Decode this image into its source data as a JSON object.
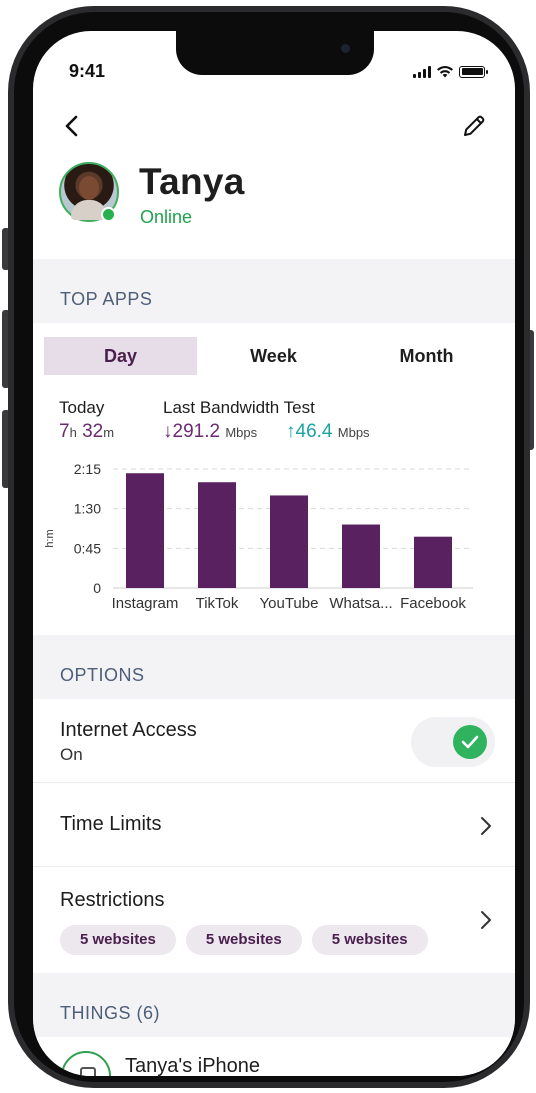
{
  "status_bar": {
    "time": "9:41"
  },
  "header": {
    "back_icon": "chevron-left-icon",
    "edit_icon": "pencil-icon"
  },
  "profile": {
    "name": "Tanya",
    "status": "Online",
    "status_color": "#1fa24a"
  },
  "top_apps": {
    "section_title": "TOP APPS",
    "tabs": [
      {
        "label": "Day",
        "selected": true
      },
      {
        "label": "Week",
        "selected": false
      },
      {
        "label": "Month",
        "selected": false
      }
    ],
    "today_label": "Today",
    "today_hours": "7",
    "today_hours_unit": "h",
    "today_minutes": "32",
    "today_minutes_unit": "m",
    "bandwidth_label": "Last Bandwidth Test",
    "download_value": "291.2",
    "upload_value": "46.4",
    "speed_unit": "Mbps"
  },
  "chart_data": {
    "type": "bar",
    "categories": [
      "Instagram",
      "TikTok",
      "YouTube",
      "Whatsa...",
      "Facebook"
    ],
    "values": [
      2.17,
      2.0,
      1.75,
      1.2,
      0.97
    ],
    "ylabel": "h:m",
    "ylim": [
      0,
      2.25
    ],
    "yticks": [
      0,
      0.75,
      1.5,
      2.25
    ],
    "ytick_labels": [
      "0",
      "0:45",
      "1:30",
      "2:15"
    ],
    "bar_color": "#5a2160",
    "grid": true
  },
  "options": {
    "section_title": "OPTIONS",
    "internet_access": {
      "title": "Internet Access",
      "value": "On",
      "toggle_on": true
    },
    "time_limits": {
      "title": "Time Limits"
    },
    "restrictions": {
      "title": "Restrictions",
      "pills": [
        "5 websites",
        "5 websites",
        "5 websites"
      ]
    }
  },
  "things": {
    "section_title": "THINGS (6)",
    "items": [
      {
        "name": "Tanya's iPhone",
        "icon": "phone-icon"
      }
    ]
  }
}
